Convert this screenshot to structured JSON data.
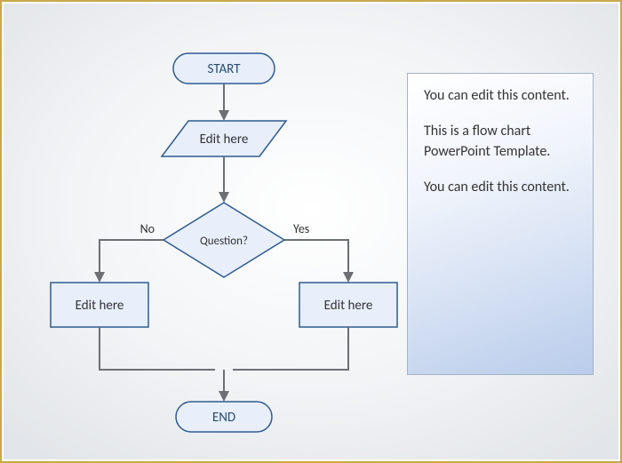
{
  "flow": {
    "start": {
      "label": "START"
    },
    "input": {
      "label": "Edit here"
    },
    "decision": {
      "label": "Question?",
      "noLabel": "No",
      "yesLabel": "Yes"
    },
    "procLeft": {
      "label": "Edit here"
    },
    "procRight": {
      "label": "Edit here"
    },
    "end": {
      "label": "END"
    }
  },
  "panel": {
    "p1": "You can edit this content.",
    "p2": "This is a flow chart PowerPoint Template.",
    "p3": "You can edit this content."
  },
  "chart_data": {
    "type": "flowchart",
    "title": "",
    "nodes": [
      {
        "id": "start",
        "shape": "terminator",
        "label": "START"
      },
      {
        "id": "input",
        "shape": "parallelogram",
        "label": "Edit here"
      },
      {
        "id": "decision",
        "shape": "diamond",
        "label": "Question?"
      },
      {
        "id": "procL",
        "shape": "process",
        "label": "Edit here"
      },
      {
        "id": "procR",
        "shape": "process",
        "label": "Edit here"
      },
      {
        "id": "end",
        "shape": "terminator",
        "label": "END"
      }
    ],
    "edges": [
      {
        "from": "start",
        "to": "input"
      },
      {
        "from": "input",
        "to": "decision"
      },
      {
        "from": "decision",
        "to": "procL",
        "label": "No"
      },
      {
        "from": "decision",
        "to": "procR",
        "label": "Yes"
      },
      {
        "from": "procL",
        "to": "end"
      },
      {
        "from": "procR",
        "to": "end"
      }
    ],
    "annotations": [
      "You can edit this content.",
      "This is a flow chart PowerPoint Template.",
      "You can edit this content."
    ]
  }
}
